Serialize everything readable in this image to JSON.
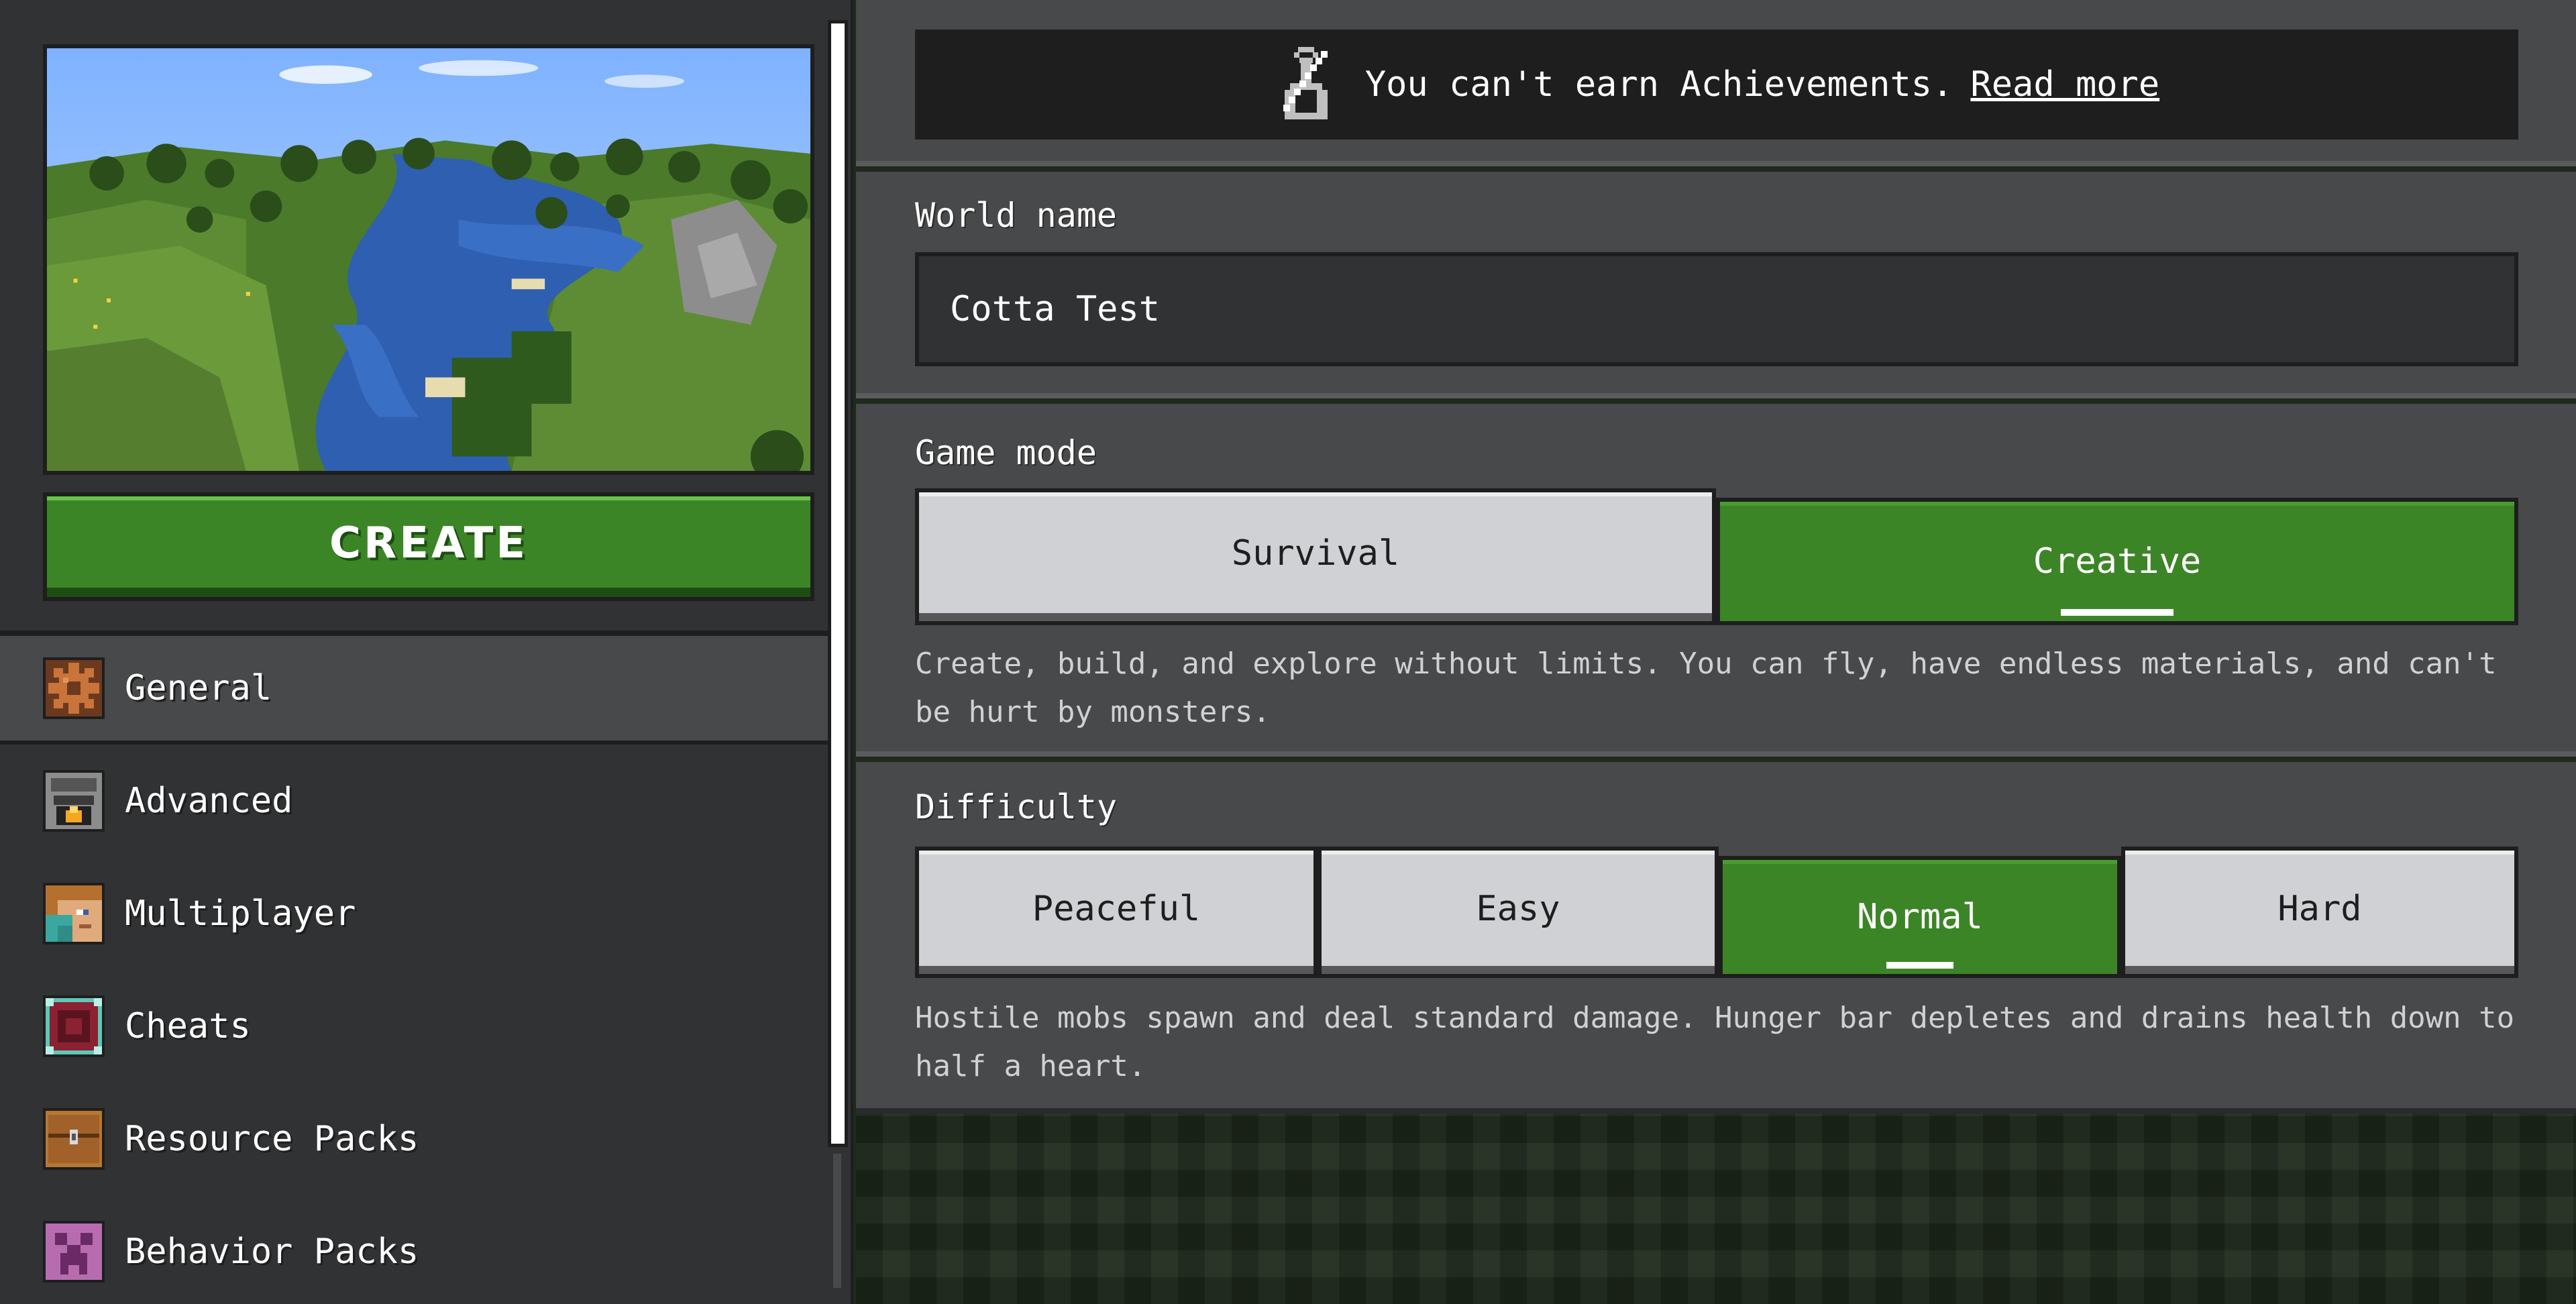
{
  "sidebar": {
    "create_label": "CREATE",
    "items": [
      {
        "label": "General",
        "icon": "gear-icon",
        "selected": true
      },
      {
        "label": "Advanced",
        "icon": "furnace-icon",
        "selected": false
      },
      {
        "label": "Multiplayer",
        "icon": "player-face-icon",
        "selected": false
      },
      {
        "label": "Cheats",
        "icon": "command-block-icon",
        "selected": false
      },
      {
        "label": "Resource Packs",
        "icon": "chest-icon",
        "selected": false
      },
      {
        "label": "Behavior Packs",
        "icon": "creeper-icon",
        "selected": false
      }
    ]
  },
  "banner": {
    "text": "You can't earn Achievements.",
    "link": "Read more",
    "icon": "no-achievements-icon"
  },
  "world_name": {
    "label": "World name",
    "value": "Cotta Test"
  },
  "game_mode": {
    "label": "Game mode",
    "options": [
      {
        "label": "Survival",
        "selected": false
      },
      {
        "label": "Creative",
        "selected": true
      }
    ],
    "description": "Create, build, and explore without limits. You can fly, have endless materials, and can't be hurt by monsters."
  },
  "difficulty": {
    "label": "Difficulty",
    "options": [
      {
        "label": "Peaceful",
        "selected": false
      },
      {
        "label": "Easy",
        "selected": false
      },
      {
        "label": "Normal",
        "selected": true
      },
      {
        "label": "Hard",
        "selected": false
      }
    ],
    "description": "Hostile mobs spawn and deal standard damage. Hunger bar depletes and drains health down to half a heart."
  },
  "colors": {
    "accent_green": "#3c8527",
    "panel": "#48494a",
    "sidebar": "#313233",
    "button_off": "#d0d1d4"
  }
}
